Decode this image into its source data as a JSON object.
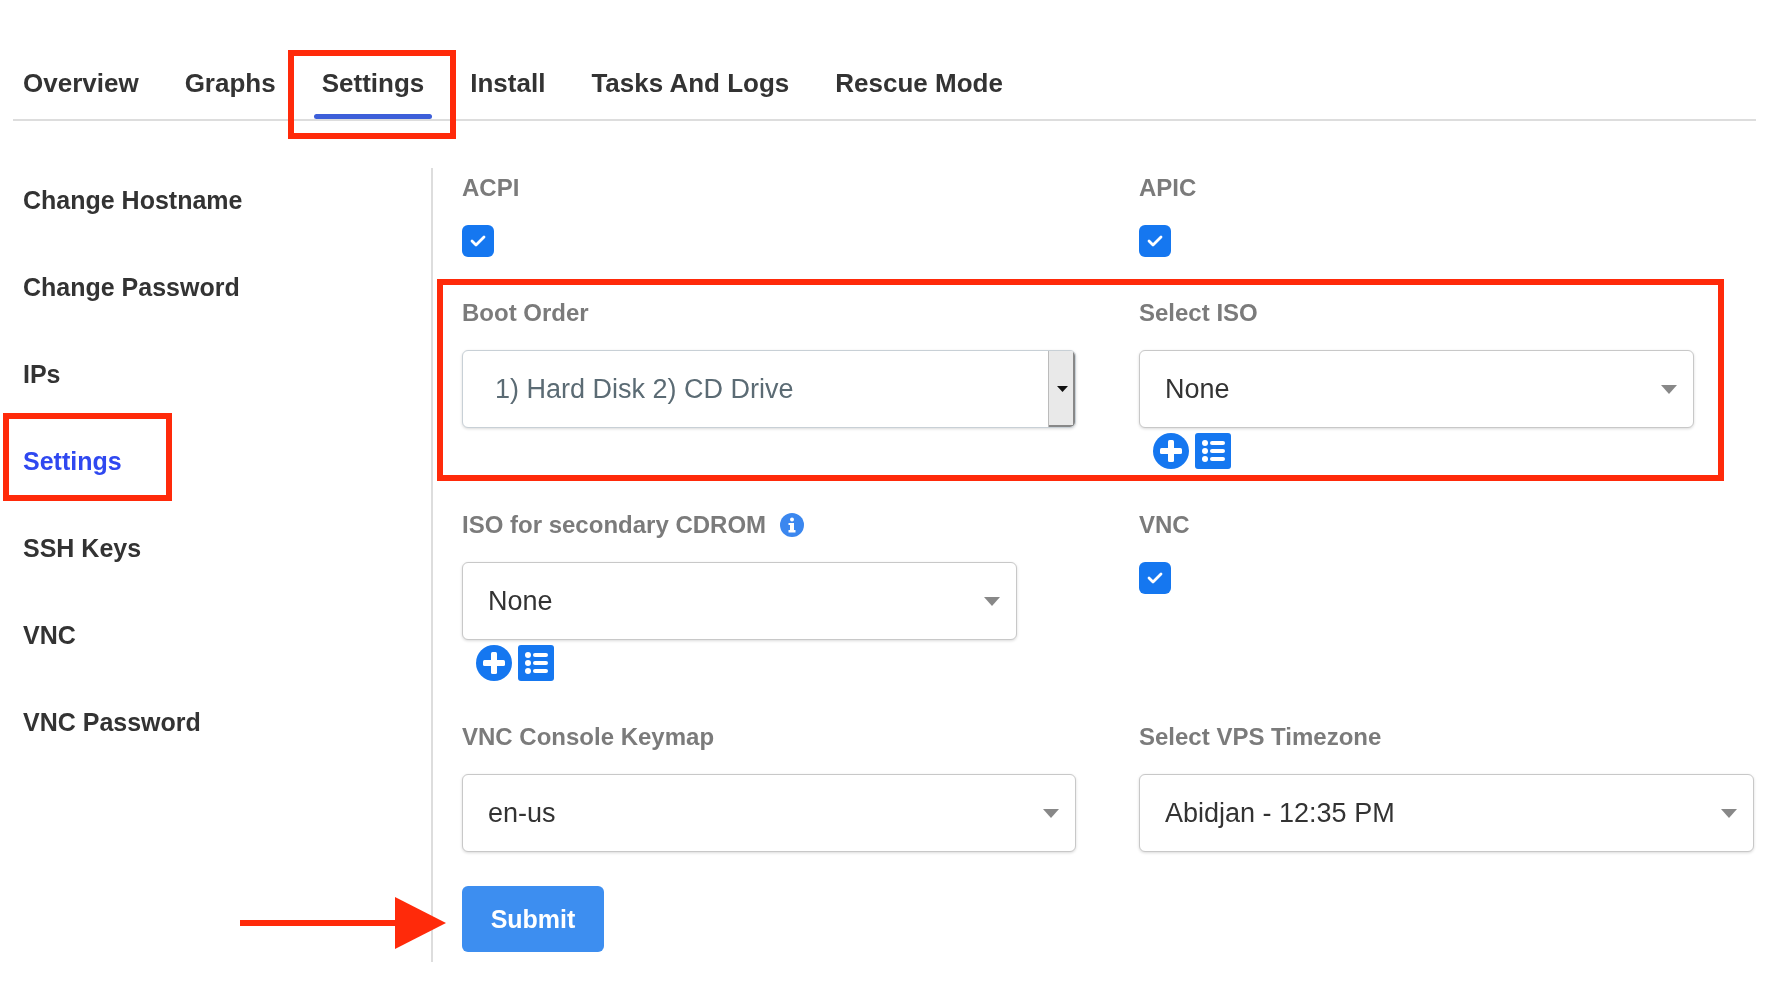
{
  "tabs": [
    {
      "label": "Overview",
      "selected": false
    },
    {
      "label": "Graphs",
      "selected": false
    },
    {
      "label": "Settings",
      "selected": true
    },
    {
      "label": "Install",
      "selected": false
    },
    {
      "label": "Tasks And Logs",
      "selected": false
    },
    {
      "label": "Rescue Mode",
      "selected": false
    }
  ],
  "sidebar": {
    "items": [
      {
        "label": "Change Hostname",
        "selected": false
      },
      {
        "label": "Change Password",
        "selected": false
      },
      {
        "label": "IPs",
        "selected": false
      },
      {
        "label": "Settings",
        "selected": true
      },
      {
        "label": "SSH Keys",
        "selected": false
      },
      {
        "label": "VNC",
        "selected": false
      },
      {
        "label": "VNC Password",
        "selected": false
      }
    ]
  },
  "form": {
    "fields": [
      {
        "kind": "checkbox",
        "label": "ACPI",
        "checked": true
      },
      {
        "kind": "checkbox",
        "label": "APIC",
        "checked": true
      },
      {
        "kind": "listbox",
        "label": "Boot Order",
        "value": "1) Hard Disk 2) CD Drive"
      },
      {
        "kind": "select",
        "label": "Select ISO",
        "value": "None",
        "iso_actions": true
      },
      {
        "kind": "select",
        "label": "ISO for secondary CDROM",
        "value": "None",
        "info": true,
        "iso_actions": true
      },
      {
        "kind": "checkbox",
        "label": "VNC",
        "checked": true
      },
      {
        "kind": "select",
        "label": "VNC Console Keymap",
        "value": "en-us"
      },
      {
        "kind": "select",
        "label": "Select VPS Timezone",
        "value": "Abidjan - 12:35 PM"
      }
    ],
    "submit": "Submit"
  }
}
